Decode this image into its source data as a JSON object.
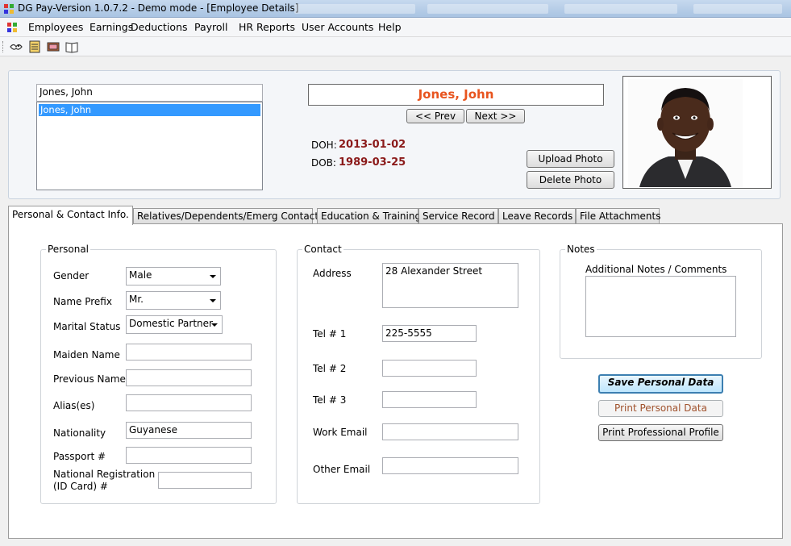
{
  "window": {
    "title": "DG Pay-Version 1.0.7.2 - Demo mode - [Employee Details]"
  },
  "menu": [
    "Employees",
    "Earnings",
    "Deductions",
    "Payroll",
    "HR Reports",
    "User Accounts",
    "Help"
  ],
  "toolbar": {
    "icons": [
      "bird-icon",
      "printer-icon",
      "money-icon",
      "book-icon"
    ]
  },
  "employee_search": {
    "value": "Jones, John"
  },
  "employee_list": {
    "items": [
      "Jones, John"
    ]
  },
  "header": {
    "name": "Jones, John",
    "prev_label": "<< Prev",
    "next_label": "Next >>",
    "doh_label": "DOH:",
    "doh_value": "2013-01-02",
    "dob_label": "DOB:",
    "dob_value": "1989-03-25",
    "upload_photo": "Upload Photo",
    "delete_photo": "Delete Photo"
  },
  "tabs": [
    {
      "label": "Personal & Contact Info.",
      "active": true
    },
    {
      "label": "Relatives/Dependents/Emerg Contact"
    },
    {
      "label": "Education & Training"
    },
    {
      "label": "Service Record"
    },
    {
      "label": "Leave Records"
    },
    {
      "label": "File Attachments"
    }
  ],
  "personal": {
    "group_label": "Personal",
    "gender_label": "Gender",
    "gender_value": "Male",
    "prefix_label": "Name Prefix",
    "prefix_value": "Mr.",
    "marital_label": "Marital Status",
    "marital_value": "Domestic Partner",
    "maiden_label": "Maiden Name",
    "maiden_value": "",
    "previous_label": "Previous Name",
    "previous_value": "",
    "alias_label": "Alias(es)",
    "alias_value": "",
    "nationality_label": "Nationality",
    "nationality_value": "Guyanese",
    "passport_label": "Passport #",
    "passport_value": "",
    "nat_reg_label_1": "National Registration",
    "nat_reg_label_2": "(ID Card) #",
    "nat_reg_value": ""
  },
  "contact": {
    "group_label": "Contact",
    "address_label": "Address",
    "address_value": "28 Alexander Street",
    "tel1_label": "Tel # 1",
    "tel1_value": "225-5555",
    "tel2_label": "Tel # 2",
    "tel2_value": "",
    "tel3_label": "Tel # 3",
    "tel3_value": "",
    "work_email_label": "Work Email",
    "work_email_value": "",
    "other_email_label": "Other Email",
    "other_email_value": ""
  },
  "notes": {
    "group_label": "Notes",
    "comments_label": "Additional Notes / Comments",
    "comments_value": ""
  },
  "actions": {
    "save": "Save Personal Data",
    "print": "Print Personal Data",
    "print_profile": "Print Professional Profile"
  },
  "colors": {
    "name_accent": "#e8541e",
    "date_accent": "#8b1a1a",
    "selection": "#3399ff"
  }
}
